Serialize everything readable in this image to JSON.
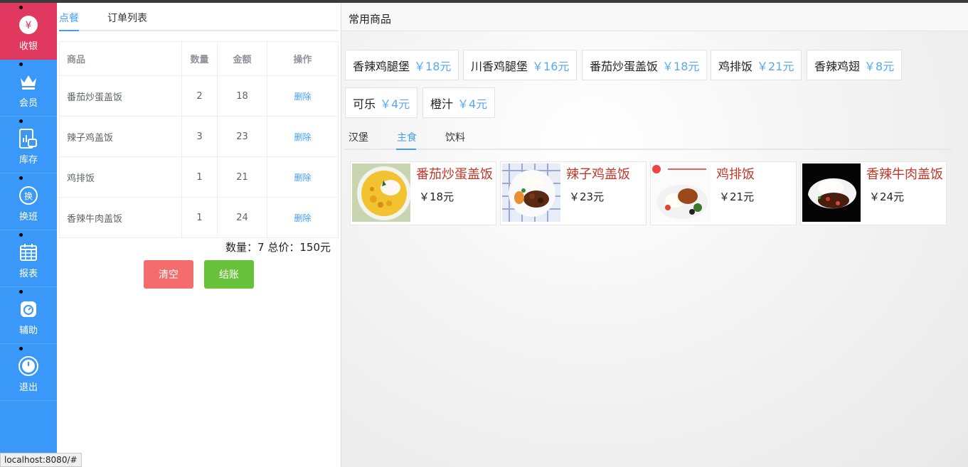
{
  "nav": {
    "items": [
      {
        "label": "收银",
        "icon": "cashier-icon"
      },
      {
        "label": "会员",
        "icon": "crown-icon"
      },
      {
        "label": "库存",
        "icon": "inventory-icon"
      },
      {
        "label": "换班",
        "icon": "shift-icon"
      },
      {
        "label": "报表",
        "icon": "calendar-icon"
      },
      {
        "label": "辅助",
        "icon": "assist-icon"
      },
      {
        "label": "退出",
        "icon": "clock-icon"
      }
    ],
    "cashier_symbol": "¥",
    "shift_symbol": "换"
  },
  "order_tabs": [
    "点餐",
    "订单列表"
  ],
  "order_table": {
    "headers": [
      "商品",
      "数量",
      "金额",
      "操作"
    ],
    "rows": [
      {
        "name": "番茄炒蛋盖饭",
        "qty": "2",
        "amount": "18",
        "action": "删除"
      },
      {
        "name": "辣子鸡盖饭",
        "qty": "3",
        "amount": "23",
        "action": "删除"
      },
      {
        "name": "鸡排饭",
        "qty": "1",
        "amount": "21",
        "action": "删除"
      },
      {
        "name": "香辣牛肉盖饭",
        "qty": "1",
        "amount": "24",
        "action": "删除"
      }
    ]
  },
  "summary": "数量：7 总价：150元",
  "buttons": {
    "clear": "清空",
    "checkout": "结账"
  },
  "goods": {
    "title": "常用商品",
    "common": [
      {
        "name": "香辣鸡腿堡",
        "price": "￥18元"
      },
      {
        "name": "川香鸡腿堡",
        "price": "￥16元"
      },
      {
        "name": "番茄炒蛋盖饭",
        "price": "￥18元"
      },
      {
        "name": "鸡排饭",
        "price": "￥21元"
      },
      {
        "name": "香辣鸡翅",
        "price": "￥8元"
      },
      {
        "name": "可乐",
        "price": "￥4元"
      },
      {
        "name": "橙汁",
        "price": "￥4元"
      }
    ],
    "categories": [
      "汉堡",
      "主食",
      "饮料"
    ],
    "foods": [
      {
        "name": "番茄炒蛋盖饭",
        "price": "￥18元"
      },
      {
        "name": "辣子鸡盖饭",
        "price": "￥23元"
      },
      {
        "name": "鸡排饭",
        "price": "￥21元"
      },
      {
        "name": "香辣牛肉盖饭",
        "price": "￥24元"
      }
    ]
  },
  "status_url": "localhost:8080/#",
  "colors": {
    "nav_bg": "#3a98f8",
    "nav_active": "#e0385e",
    "accent": "#409eff",
    "clear": "#f56c6c",
    "checkout": "#67c23a",
    "food_name": "#c0392b"
  }
}
